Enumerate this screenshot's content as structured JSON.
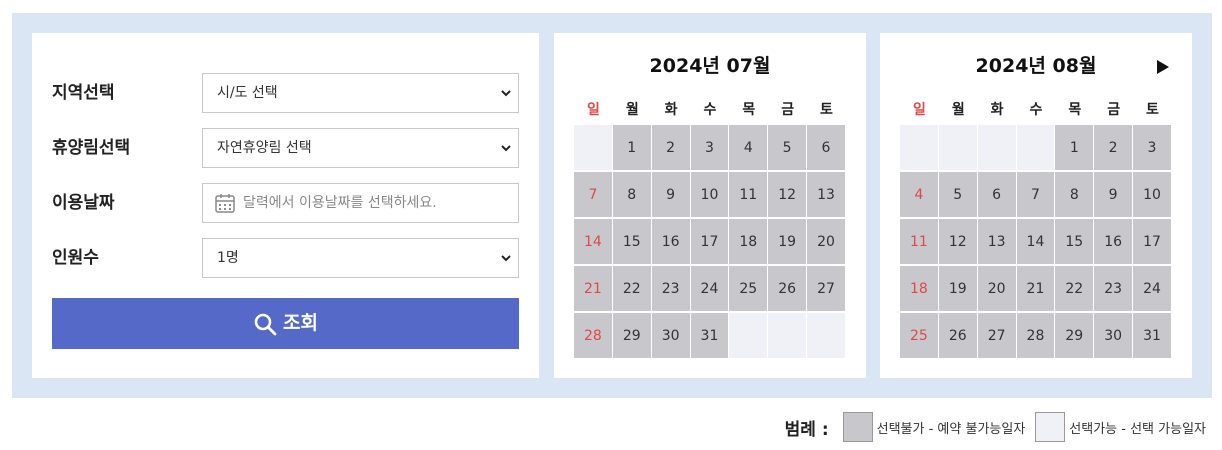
{
  "form": {
    "region": {
      "label": "지역선택",
      "value": "시/도 선택"
    },
    "forest": {
      "label": "휴양림선택",
      "value": "자연휴양림 선택"
    },
    "date": {
      "label": "이용날짜",
      "placeholder": "달력에서 이용날짜를 선택하세요."
    },
    "people": {
      "label": "인원수",
      "value": "1명"
    },
    "search_label": "조회"
  },
  "weekdays": [
    "일",
    "월",
    "화",
    "수",
    "목",
    "금",
    "토"
  ],
  "calendars": [
    {
      "title": "2024년 07월",
      "first_weekday": 1,
      "days_in_month": 31,
      "available_days": []
    },
    {
      "title": "2024년 08월",
      "first_weekday": 4,
      "days_in_month": 31,
      "available_days": [],
      "show_next": true
    }
  ],
  "legend": {
    "title": "범례 :",
    "unavailable": "선택불가 - 예약 불가능일자",
    "available": "선택가능 - 선택 가능일자"
  },
  "colors": {
    "button": "#5569c8",
    "unavailable": "#c8c8cc",
    "available": "#eff1f7",
    "sunday": "#e04848",
    "frame": "#dae6f4"
  }
}
